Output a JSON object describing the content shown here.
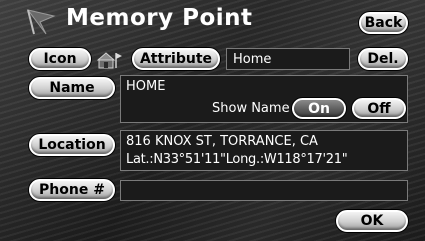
{
  "header": {
    "title": "Memory Point",
    "back_label": "Back"
  },
  "icon_row": {
    "icon_label": "Icon",
    "attribute_label": "Attribute",
    "attribute_value": "Home",
    "delete_label": "Del.",
    "icon_glyph": "house-flag-icon"
  },
  "name_row": {
    "label": "Name",
    "value": "HOME",
    "show_name_label": "Show Name",
    "on_label": "On",
    "off_label": "Off",
    "show_name_state": "On"
  },
  "location_row": {
    "label": "Location",
    "address": "816 KNOX ST, TORRANCE, CA",
    "coordinates": "Lat.:N33°51'11\"Long.:W118°17'21\""
  },
  "phone_row": {
    "label": "Phone #",
    "value": ""
  },
  "footer": {
    "ok_label": "OK"
  }
}
